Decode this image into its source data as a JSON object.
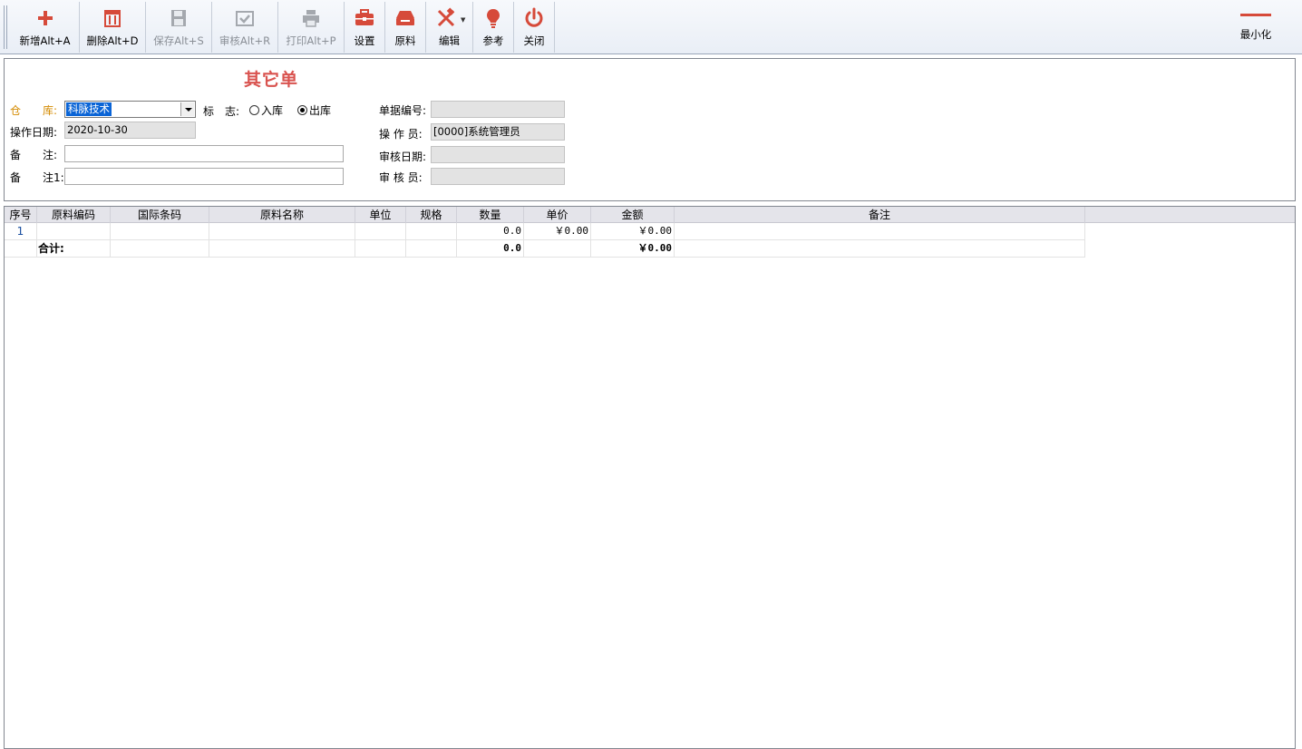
{
  "toolbar": {
    "buttons": [
      {
        "label": "新增Alt+A",
        "icon": "plus-icon",
        "enabled": true
      },
      {
        "label": "删除Alt+D",
        "icon": "trash-icon",
        "enabled": true
      },
      {
        "label": "保存Alt+S",
        "icon": "save-icon",
        "enabled": false
      },
      {
        "label": "审核Alt+R",
        "icon": "approve-icon",
        "enabled": false
      },
      {
        "label": "打印Alt+P",
        "icon": "printer-icon",
        "enabled": false
      },
      {
        "label": "设置",
        "icon": "toolbox-icon",
        "enabled": true
      },
      {
        "label": "原料",
        "icon": "tray-icon",
        "enabled": true
      },
      {
        "label": "编辑",
        "icon": "edit-tools-icon",
        "enabled": true
      },
      {
        "label": "参考",
        "icon": "lightbulb-icon",
        "enabled": true
      },
      {
        "label": "关闭",
        "icon": "power-icon",
        "enabled": true
      }
    ],
    "minimize_label": "最小化"
  },
  "header": {
    "title": "其它单",
    "warehouse_label": "仓　　库:",
    "warehouse_value": "科脉技术",
    "flag_label": "标　志:",
    "flag_in": "入库",
    "flag_out": "出库",
    "flag_selected": "出库",
    "op_date_label": "操作日期:",
    "op_date_value": "2020-10-30",
    "remark_label": "备　　注:",
    "remark_value": "",
    "remark1_label": "备　　注1:",
    "remark1_value": "",
    "doc_no_label": "单据编号:",
    "doc_no_value": "",
    "operator_label": "操 作 员:",
    "operator_value": "[0000]系统管理员",
    "audit_date_label": "审核日期:",
    "audit_date_value": "",
    "auditor_label": "审 核 员:",
    "auditor_value": ""
  },
  "grid": {
    "columns": [
      "序号",
      "原料编码",
      "国际条码",
      "原料名称",
      "单位",
      "规格",
      "数量",
      "单价",
      "金额",
      "备注"
    ],
    "rows": [
      {
        "no": "1",
        "code": "",
        "barcode": "",
        "name": "",
        "unit": "",
        "spec": "",
        "qty": "0.0",
        "price": "￥0.00",
        "amount": "￥0.00",
        "remark": ""
      }
    ],
    "total": {
      "label": "合计:",
      "qty": "0.0",
      "amount": "￥0.00"
    }
  },
  "colors": {
    "accent_red": "#d9534f",
    "warn_label": "#d48a00",
    "selection_blue": "#0a64d6"
  }
}
